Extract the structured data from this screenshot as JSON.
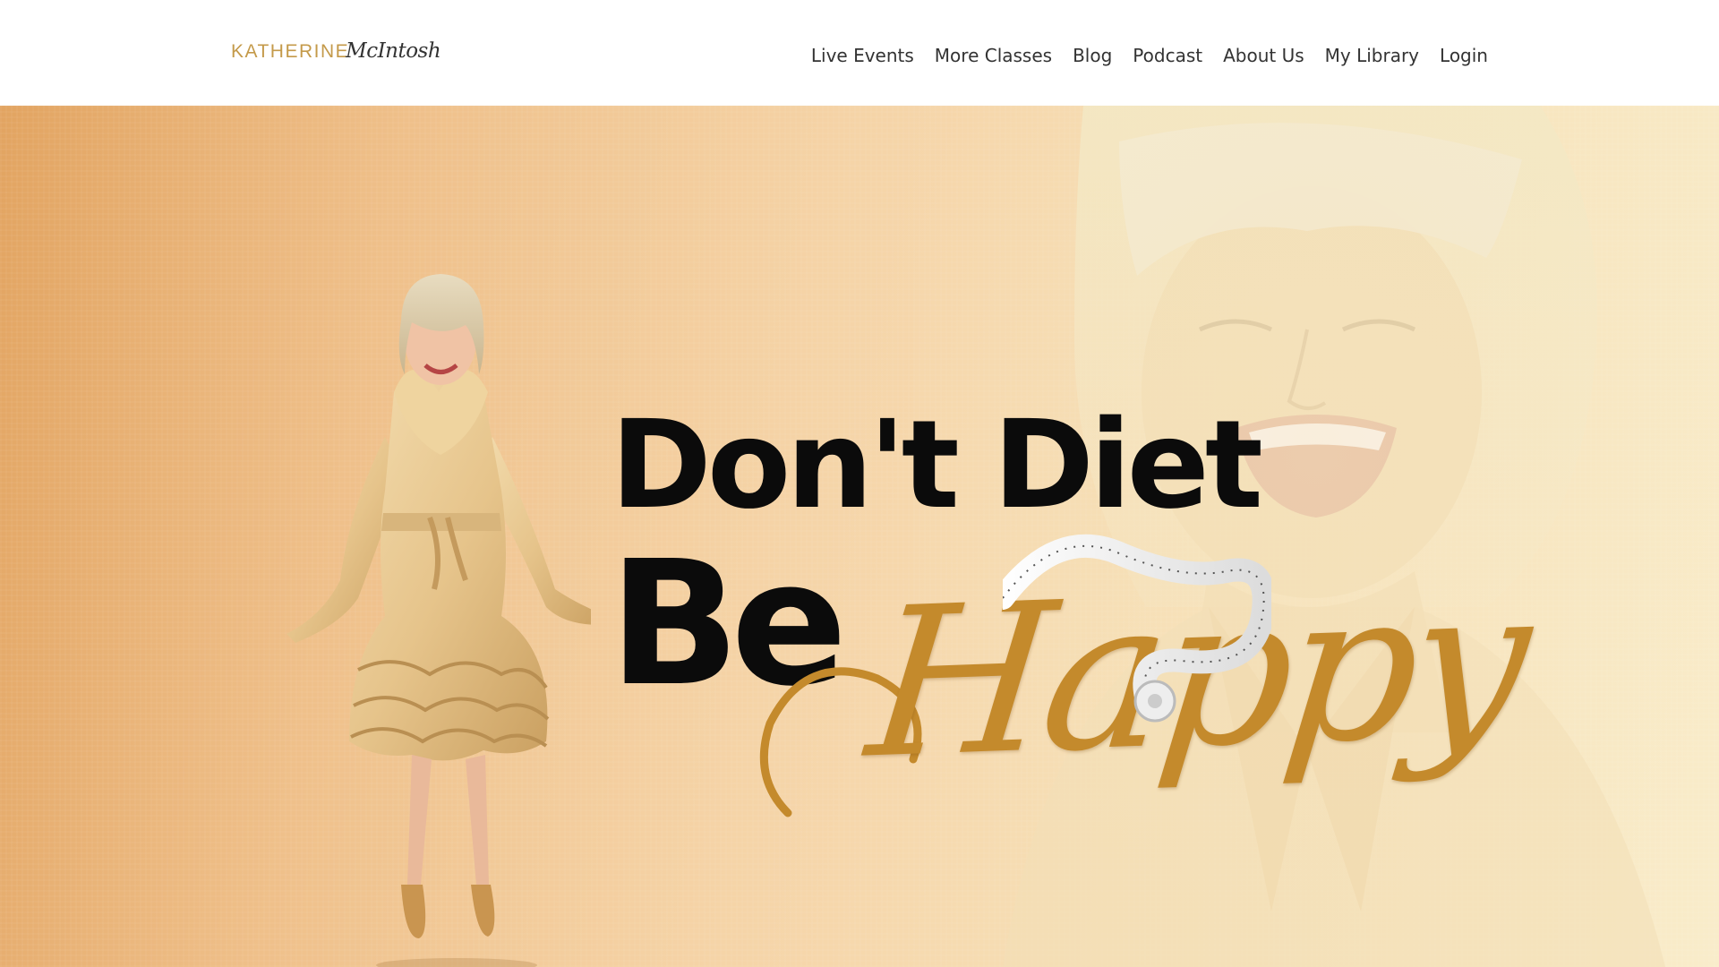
{
  "header": {
    "logo": {
      "first": "KATHERINE",
      "last": "McIntosh"
    },
    "nav": [
      {
        "label": "Live Events"
      },
      {
        "label": "More Classes"
      },
      {
        "label": "Blog"
      },
      {
        "label": "Podcast"
      },
      {
        "label": "About Us"
      },
      {
        "label": "My Library"
      },
      {
        "label": "Login"
      }
    ]
  },
  "hero": {
    "headline_line1": "Don't Diet",
    "headline_line2": "Be",
    "headline_script": "Happy"
  },
  "colors": {
    "logo_gold": "#c49a4a",
    "script_gold": "#c48a2c",
    "hero_gradient_start": "#e2a461",
    "hero_gradient_end": "#f9ecca",
    "nav_text": "#333333"
  }
}
